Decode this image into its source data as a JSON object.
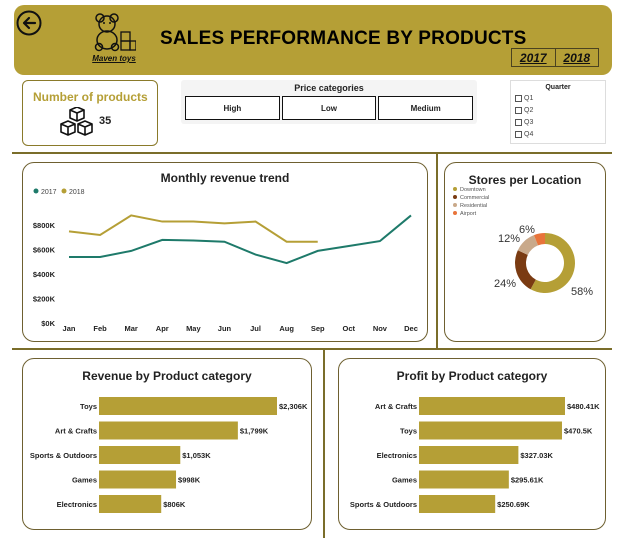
{
  "header": {
    "title": "SALES PERFORMANCE BY PRODUCTS",
    "logo_caption": "Maven toys",
    "years": [
      "2017",
      "2018"
    ]
  },
  "kpi": {
    "label": "Number of products",
    "value": "35"
  },
  "price_filter": {
    "title": "Price categories",
    "options": [
      "High",
      "Low",
      "Medium"
    ]
  },
  "quarter_filter": {
    "title": "Quarter",
    "options": [
      "Q1",
      "Q2",
      "Q3",
      "Q4"
    ]
  },
  "colors": {
    "accent": "#b59f36",
    "teal": "#1e7a6a",
    "brown": "#7a3b12",
    "tan": "#c9a98a",
    "orange": "#e8743b"
  },
  "charts": {
    "line_title": "Monthly revenue trend",
    "donut_title": "Stores per Location",
    "revenue_title": "Revenue by Product category",
    "profit_title": "Profit by Product category"
  },
  "chart_data": [
    {
      "type": "line",
      "title": "Monthly revenue trend",
      "x": [
        "Jan",
        "Feb",
        "Mar",
        "Apr",
        "May",
        "Jun",
        "Jul",
        "Aug",
        "Sep",
        "Oct",
        "Nov",
        "Dec"
      ],
      "y_ticks": [
        "$0K",
        "$200K",
        "$400K",
        "$600K",
        "$800K"
      ],
      "ylim": [
        0,
        900
      ],
      "legend": "top-left",
      "series": [
        {
          "name": "2017",
          "color": "#1e7a6a",
          "values": [
            540,
            540,
            590,
            680,
            675,
            665,
            560,
            490,
            590,
            630,
            670,
            880
          ]
        },
        {
          "name": "2018",
          "color": "#b59f36",
          "values": [
            750,
            720,
            880,
            830,
            830,
            815,
            830,
            665,
            665,
            null,
            null,
            null
          ]
        }
      ]
    },
    {
      "type": "pie",
      "title": "Stores per Location",
      "legend": "top-left",
      "labels": [
        "Downtown",
        "Commercial",
        "Residential",
        "Airport"
      ],
      "values": [
        58,
        24,
        12,
        6
      ],
      "value_labels": [
        "58%",
        "24%",
        "12%",
        "6%"
      ],
      "colors": [
        "#b59f36",
        "#7a3b12",
        "#c9a98a",
        "#e8743b"
      ]
    },
    {
      "type": "bar",
      "title": "Revenue by Product category",
      "categories": [
        "Toys",
        "Art & Crafts",
        "Sports & Outdoors",
        "Games",
        "Electronics"
      ],
      "values": [
        2306,
        1799,
        1053,
        998,
        806
      ],
      "value_labels": [
        "$2,306K",
        "$1,799K",
        "$1,053K",
        "$998K",
        "$806K"
      ],
      "max": 2306
    },
    {
      "type": "bar",
      "title": "Profit by Product category",
      "categories": [
        "Art & Crafts",
        "Toys",
        "Electronics",
        "Games",
        "Sports & Outdoors"
      ],
      "values": [
        480.41,
        470.5,
        327.03,
        295.61,
        250.69
      ],
      "value_labels": [
        "$480.41K",
        "$470.5K",
        "$327.03K",
        "$295.61K",
        "$250.69K"
      ],
      "max": 480.41
    }
  ]
}
